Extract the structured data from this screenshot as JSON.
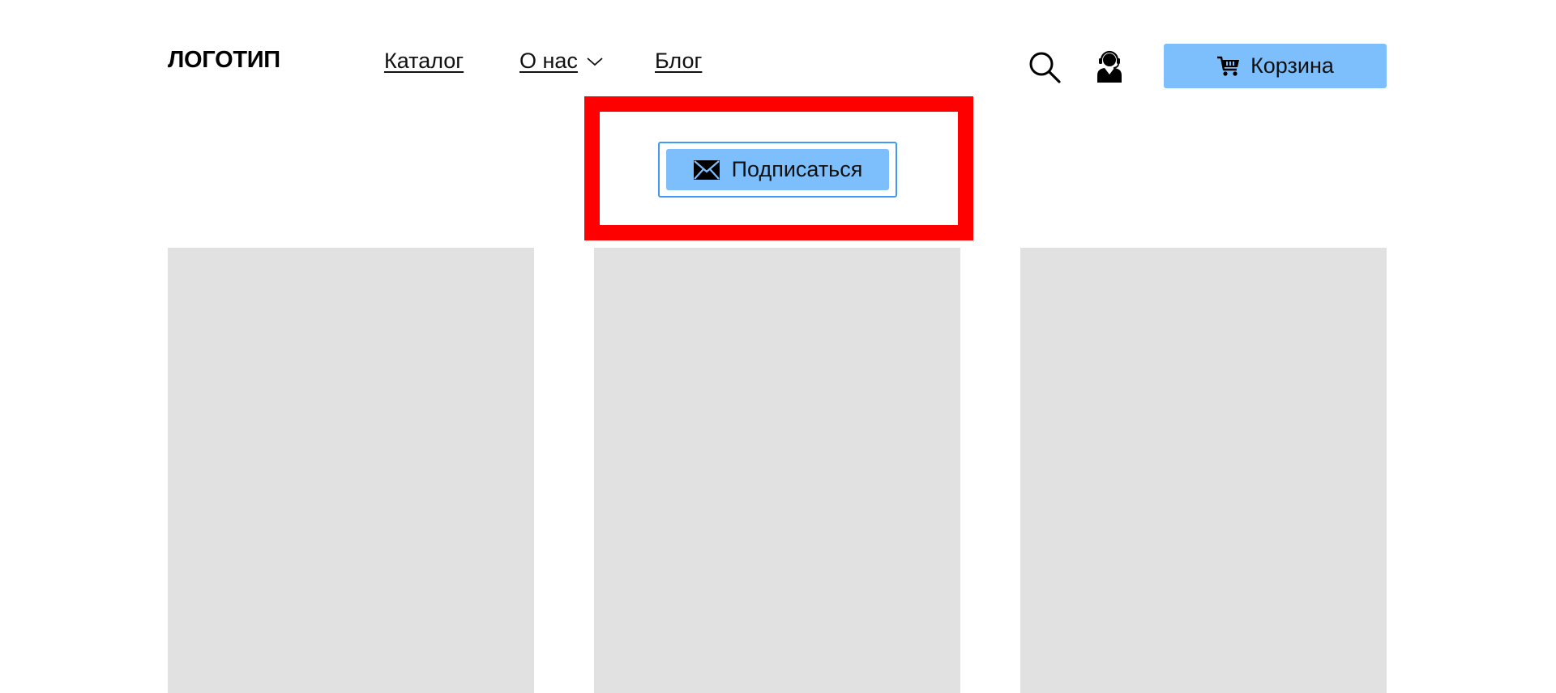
{
  "header": {
    "logo": "ЛОГОТИП",
    "nav": {
      "catalog": "Каталог",
      "about": "О нас",
      "blog": "Блог"
    },
    "icons": {
      "search": "search-icon",
      "support": "support-agent-icon",
      "cart": "cart-icon",
      "dropdown": "chevron-down-icon"
    },
    "cart_label": "Корзина"
  },
  "subscribe": {
    "label": "Подписаться",
    "icon": "envelope-icon"
  },
  "colors": {
    "accent": "#7dbefc",
    "focus_border": "#3f9bf2",
    "highlight": "#ff0000",
    "placeholder": "#e1e1e1"
  },
  "cards": [
    {
      "type": "image-placeholder"
    },
    {
      "type": "image-placeholder"
    },
    {
      "type": "image-placeholder"
    }
  ]
}
